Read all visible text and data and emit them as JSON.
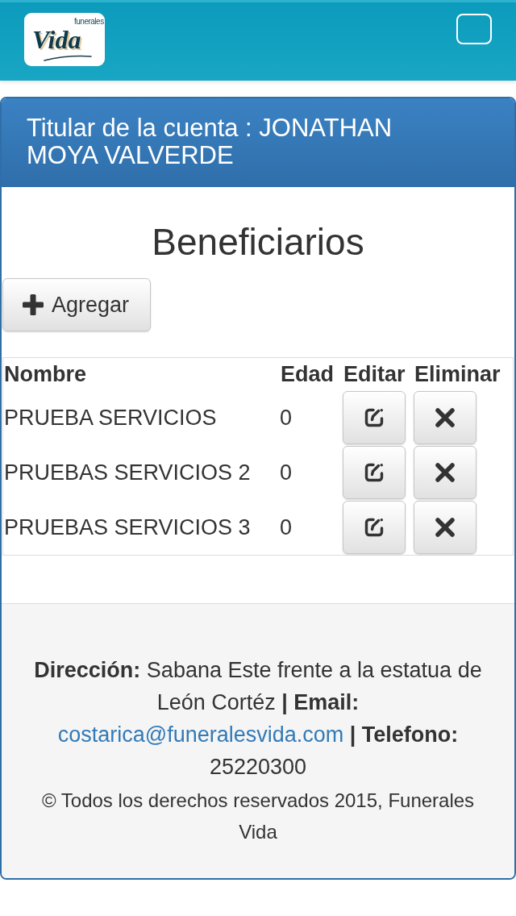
{
  "header": {
    "logo": {
      "tagline": "funerales",
      "name": "Vida"
    }
  },
  "panel": {
    "title": "Titular de la cuenta : JONATHAN MOYA VALVERDE"
  },
  "page_title": "Beneficiarios",
  "add_button": {
    "label": "Agregar"
  },
  "table": {
    "columns": [
      "Nombre",
      "Edad",
      "Editar",
      "Eliminar"
    ],
    "rows": [
      {
        "name": "PRUEBA SERVICIOS",
        "age": "0"
      },
      {
        "name": "PRUEBAS SERVICIOS 2",
        "age": "0"
      },
      {
        "name": "PRUEBAS SERVICIOS 3",
        "age": "0"
      }
    ]
  },
  "footer": {
    "contact_before": "**Dirección:** Sabana Este frente a la estatua de León Cortéz **| Email:**",
    "email": "costarica@funeralesvida.com",
    "contact_after": "**| Telefono:** 25220300",
    "copyright": "© Todos los derechos reservados 2015, Funerales Vida"
  }
}
